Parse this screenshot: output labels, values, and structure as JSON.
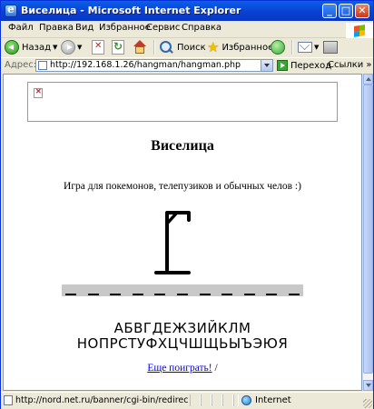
{
  "window": {
    "title": "Виселица - Microsoft Internet Explorer",
    "min_glyph": "_",
    "max_glyph": "□",
    "close_glyph": "✕"
  },
  "menu": [
    "Файл",
    "Правка",
    "Вид",
    "Избранное",
    "Сервис",
    "Справка"
  ],
  "toolbar": {
    "back_label": "Назад",
    "search_label": "Поиск",
    "favorites_label": "Избранное"
  },
  "address": {
    "label": "Адрес:",
    "url": "http://192.168.1.26/hangman/hangman.php",
    "go_label": "Переход",
    "links_label": "Ссылки"
  },
  "page": {
    "title": "Виселица",
    "subtitle": "Игра для покемонов, телепузиков и обычных челов :)",
    "word_slots": 11,
    "alphabet_row1": [
      "А",
      "Б",
      "В",
      "Г",
      "Д",
      "Е",
      "Ж",
      "З",
      "И",
      "Й",
      "К",
      "Л",
      "М"
    ],
    "alphabet_row2": [
      "Н",
      "О",
      "П",
      "Р",
      "С",
      "Т",
      "У",
      "Ф",
      "Х",
      "Ц",
      "Ч",
      "Ш",
      "Щ",
      "Ь",
      "Ы",
      "Ъ",
      "Э",
      "Ю",
      "Я"
    ],
    "play_again": "Еще поиграть!",
    "play_again_suffix": " /"
  },
  "status": {
    "text": "http://nord.net.ru/banner/cgi-bin/redirect.c",
    "zone": "Internet"
  }
}
